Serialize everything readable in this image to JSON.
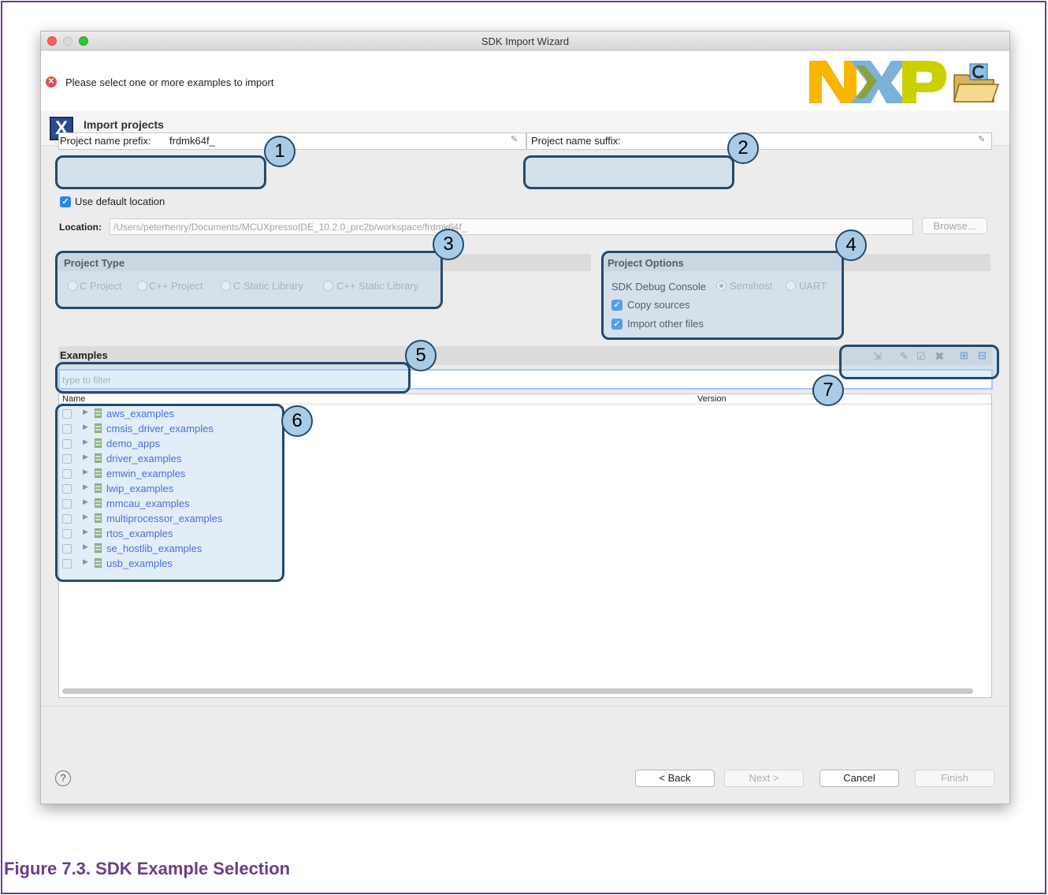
{
  "window": {
    "title": "SDK Import Wizard"
  },
  "header": {
    "error_message": "Please select one or more examples to import",
    "section_title": "Import projects",
    "logo_icon": "nxp-logo",
    "wizard_icon": "folder-c-icon"
  },
  "fields": {
    "prefix_label": "Project name prefix:",
    "prefix_value": "frdmk64f_",
    "suffix_label": "Project name suffix:",
    "suffix_value": "",
    "use_default_location": "Use default location",
    "location_label": "Location:",
    "location_value": "/Users/peterhenry/Documents/MCUXpressoIDE_10.2.0_prc2b/workspace/frdmk64f_",
    "browse": "Browse..."
  },
  "project_type": {
    "title": "Project Type",
    "options": [
      "C Project",
      "C++ Project",
      "C Static Library",
      "C++ Static Library"
    ]
  },
  "project_options": {
    "title": "Project Options",
    "debug_console_label": "SDK Debug Console",
    "debug_console_options": [
      "Semihost",
      "UART"
    ],
    "copy_sources": "Copy sources",
    "import_other_files": "Import other files"
  },
  "examples": {
    "title": "Examples",
    "filter_placeholder": "type to filter",
    "columns": [
      "Name",
      "Version"
    ],
    "items": [
      "aws_examples",
      "cmsis_driver_examples",
      "demo_apps",
      "driver_examples",
      "emwin_examples",
      "lwip_examples",
      "mmcau_examples",
      "multiprocessor_examples",
      "rtos_examples",
      "se_hostlib_examples",
      "usb_examples"
    ]
  },
  "buttons": {
    "back": "< Back",
    "next": "Next >",
    "cancel": "Cancel",
    "finish": "Finish"
  },
  "callouts": [
    "1",
    "2",
    "3",
    "4",
    "5",
    "6",
    "7"
  ],
  "caption": "Figure 7.3. SDK Example Selection",
  "colors": {
    "frame": "#6a3d8f",
    "callout_border": "#244a6a",
    "callout_fill": "#a9cbe6",
    "link": "#1a3bd8",
    "checkbox": "#2a83e8"
  }
}
